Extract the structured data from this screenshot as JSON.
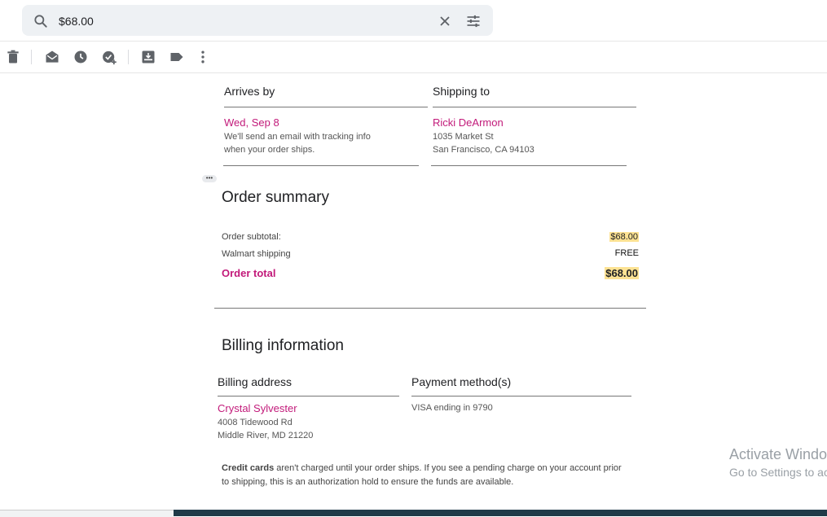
{
  "search": {
    "value": "$68.00"
  },
  "colors": {
    "accent": "#c21a7a",
    "highlight": "#fde293"
  },
  "toolbar": {
    "icons": [
      "delete-icon",
      "mark-unread-icon",
      "snooze-icon",
      "add-task-icon",
      "move-to-icon",
      "label-icon",
      "more-vert-icon"
    ]
  },
  "arrives": {
    "heading": "Arrives by",
    "date": "Wed, Sep 8",
    "note_line1": "We'll send an email with tracking info",
    "note_line2": "when your order ships."
  },
  "shipping": {
    "heading": "Shipping to",
    "name": "Ricki DeArmon",
    "street": "1035 Market St",
    "city": "San Francisco, CA 94103"
  },
  "summary": {
    "title": "Order summary",
    "subtotal_label": "Order subtotal:",
    "subtotal_value": "$68.00",
    "shipping_label": "Walmart shipping",
    "shipping_value": "FREE",
    "total_label": "Order total",
    "total_value": "$68.00"
  },
  "billing": {
    "title": "Billing information",
    "address_heading": "Billing address",
    "name": "Crystal Sylvester",
    "street": "4008 Tidewood Rd",
    "city": "Middle River, MD 21220",
    "payment_heading": "Payment method(s)",
    "payment_value": "VISA ending in 9790",
    "note_bold": "Credit cards",
    "note_rest_line1": " aren't charged until your order ships. If you see a pending charge on your account prior",
    "note_line2": "to shipping, this is an authorization hold to ensure the funds are available."
  },
  "watermark": {
    "line1": "Activate Windows",
    "line2": "Go to Settings to activate Windows."
  }
}
